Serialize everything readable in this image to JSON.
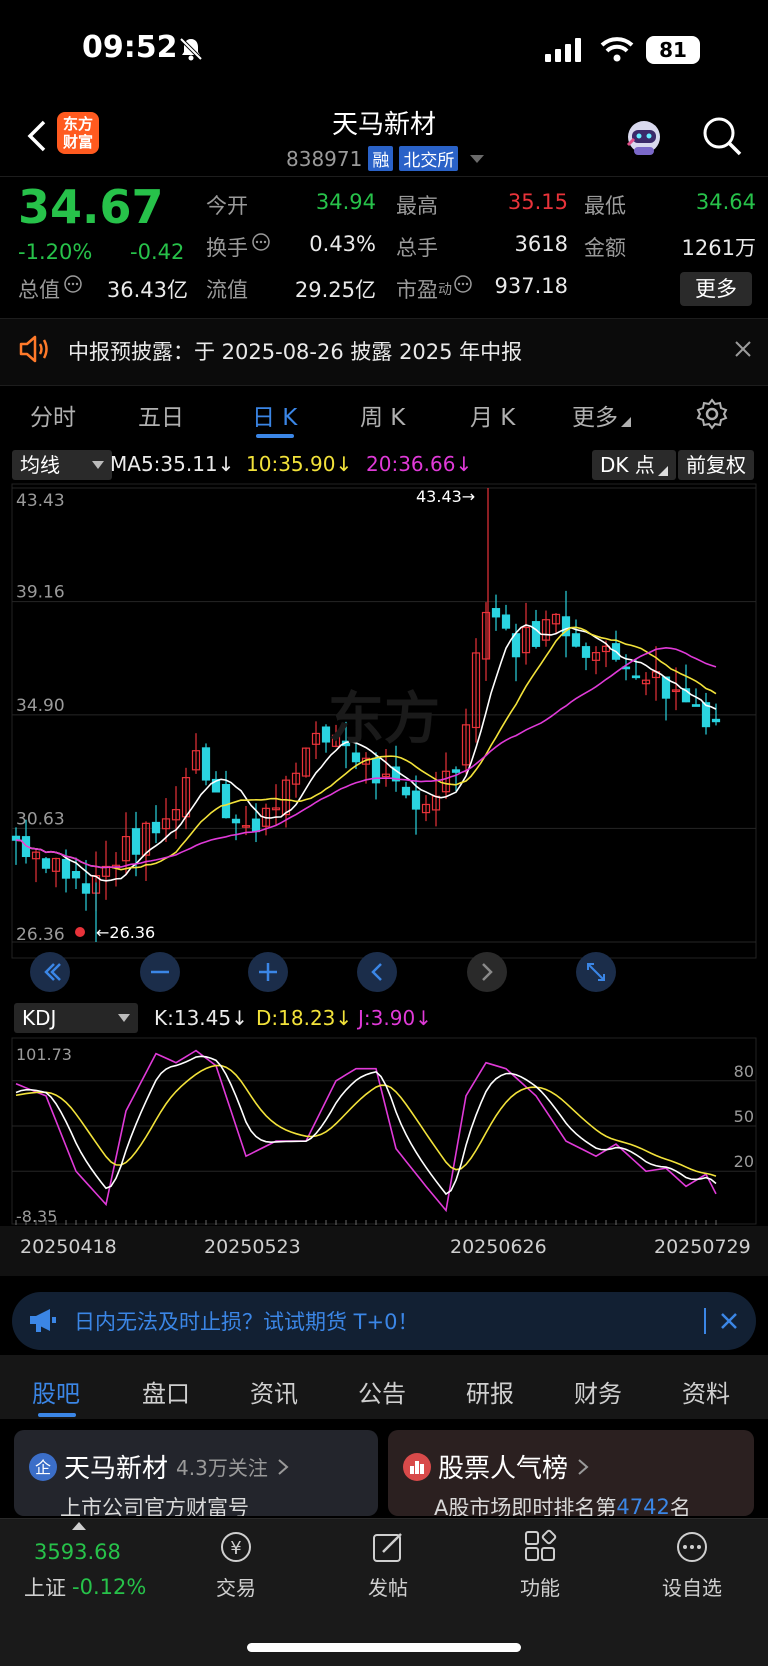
{
  "status_bar": {
    "time": "09:52",
    "battery": "81"
  },
  "header": {
    "logo_line1": "东方",
    "logo_line2": "财富",
    "title": "天马新材",
    "code": "838971",
    "tag1": "融",
    "tag2": "北交所"
  },
  "quote": {
    "price": "34.67",
    "pct": "-1.20%",
    "chg": "-0.42",
    "open_label": "今开",
    "open": "34.94",
    "high_label": "最高",
    "high": "35.15",
    "low_label": "最低",
    "low": "34.64",
    "turnover_label": "换手",
    "turnover": "0.43%",
    "volume_label": "总手",
    "volume": "3618",
    "amount_label": "金额",
    "amount": "1261万",
    "mktcap_label": "总值",
    "mktcap": "36.43亿",
    "float_label": "流值",
    "float": "29.25亿",
    "pe_label": "市盈",
    "pe_sup": "动",
    "pe": "937.18",
    "more": "更多"
  },
  "notice": {
    "text": "中报预披露：于 2025-08-26 披露 2025 年中报"
  },
  "period_tabs": [
    "分时",
    "五日",
    "日 K",
    "周 K",
    "月 K",
    "更多"
  ],
  "ma": {
    "selector": "均线",
    "ma5": "MA5:35.11↓",
    "ma10": "10:35.90↓",
    "ma20": "20:36.66↓",
    "dk": "DK 点",
    "adjust": "前复权"
  },
  "chart_data": {
    "type": "candlestick",
    "y_ticks": [
      "43.43",
      "39.16",
      "34.90",
      "30.63",
      "26.36"
    ],
    "ylim": [
      26.36,
      43.43
    ],
    "max_label": "43.43→",
    "min_label": "←26.36",
    "x_labels": [
      "20250418",
      "20250523",
      "20250626",
      "20250729"
    ]
  },
  "kdj": {
    "selector": "KDJ",
    "k": "K:13.45↓",
    "d": "D:18.23↓",
    "j": "J:3.90↓",
    "top": "101.73",
    "bottom": "-8.35",
    "levels": [
      "80",
      "50",
      "20"
    ]
  },
  "ad": {
    "text": "日内无法及时止损？试试期货 T+0！"
  },
  "info_tabs": [
    "股吧",
    "盘口",
    "资讯",
    "公告",
    "研报",
    "财务",
    "资料"
  ],
  "cards": {
    "left_title": "天马新材",
    "left_follow": "4.3万关注",
    "left_sub": "上市公司官方财富号",
    "right_title": "股票人气榜",
    "right_sub_prefix": "A股市场即时排名第",
    "right_rank": "4742",
    "right_sub_suffix": "名"
  },
  "bottom_nav": {
    "index_value": "3593.68",
    "index_name": "上证",
    "index_chg": "-0.12%",
    "trade": "交易",
    "post": "发帖",
    "func": "功能",
    "watch": "设自选"
  }
}
